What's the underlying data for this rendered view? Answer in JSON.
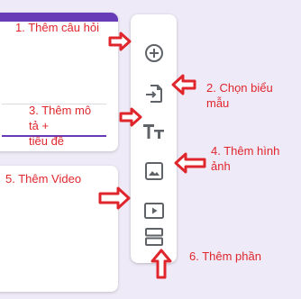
{
  "colors": {
    "accent": "#673ab7",
    "annotation": "#e0262d",
    "icon": "#5f6368",
    "background": "#efeaf7"
  },
  "toolbar": {
    "items": [
      {
        "icon": "add-circle-icon",
        "tooltip": ""
      },
      {
        "icon": "import-icon",
        "tooltip": ""
      },
      {
        "icon": "title-text-icon",
        "tooltip": ""
      },
      {
        "icon": "image-icon",
        "tooltip": ""
      },
      {
        "icon": "video-icon",
        "tooltip": ""
      },
      {
        "icon": "section-icon",
        "tooltip": ""
      }
    ]
  },
  "annotations": {
    "add_question": "1. Thêm câu hỏi",
    "import_form_line1": "2. Chọn biểu",
    "import_form_line2": "mẫu",
    "add_title_line1": "3. Thêm mô",
    "add_title_line2": "tả +",
    "add_title_line3": "tiêu đề",
    "add_image_line1": "4. Thêm hình",
    "add_image_line2": "ảnh",
    "add_video": "5. Thêm Video",
    "add_section": "6. Thêm phần"
  }
}
